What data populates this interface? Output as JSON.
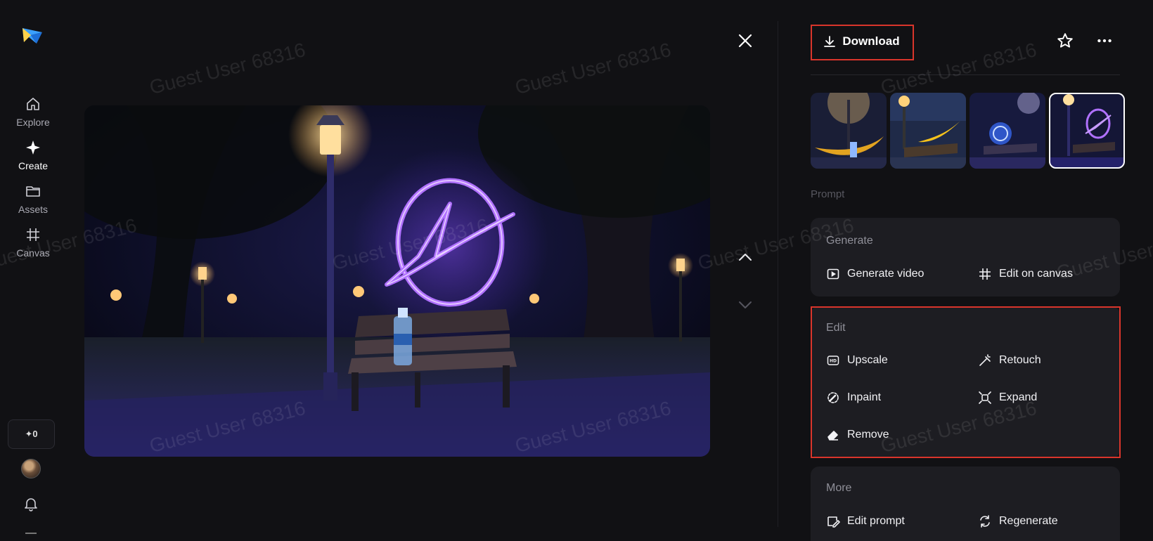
{
  "nav": {
    "items": [
      {
        "label": "Explore",
        "icon": "home-icon"
      },
      {
        "label": "Create",
        "icon": "sparkle-icon"
      },
      {
        "label": "Assets",
        "icon": "folder-icon"
      },
      {
        "label": "Canvas",
        "icon": "canvas-icon"
      }
    ],
    "active": "Create",
    "credits": "✦0"
  },
  "toolbar": {
    "download_label": "Download"
  },
  "panel": {
    "prompt_label": "Prompt",
    "generate": {
      "title": "Generate",
      "actions": [
        {
          "label": "Generate video",
          "icon": "play-square-icon"
        },
        {
          "label": "Edit on canvas",
          "icon": "canvas-icon"
        }
      ]
    },
    "edit": {
      "title": "Edit",
      "actions": [
        {
          "label": "Upscale",
          "icon": "hd-icon"
        },
        {
          "label": "Retouch",
          "icon": "magic-wand-icon"
        },
        {
          "label": "Inpaint",
          "icon": "inpaint-icon"
        },
        {
          "label": "Expand",
          "icon": "expand-icon"
        },
        {
          "label": "Remove",
          "icon": "eraser-icon"
        }
      ]
    },
    "more": {
      "title": "More",
      "actions": [
        {
          "label": "Edit prompt",
          "icon": "edit-prompt-icon"
        },
        {
          "label": "Regenerate",
          "icon": "regenerate-icon"
        }
      ]
    }
  },
  "thumbnails": [
    {
      "name": "thumb-gold-swoosh-bench"
    },
    {
      "name": "thumb-yellow-swoosh-bench"
    },
    {
      "name": "thumb-blue-coin-bench"
    },
    {
      "name": "thumb-purple-neon-bench",
      "selected": true
    }
  ],
  "watermark": "Guest User 68316",
  "colors": {
    "background": "#111114",
    "card": "#1d1d22",
    "highlight": "#d9352b",
    "neon": "#9b5cff"
  }
}
